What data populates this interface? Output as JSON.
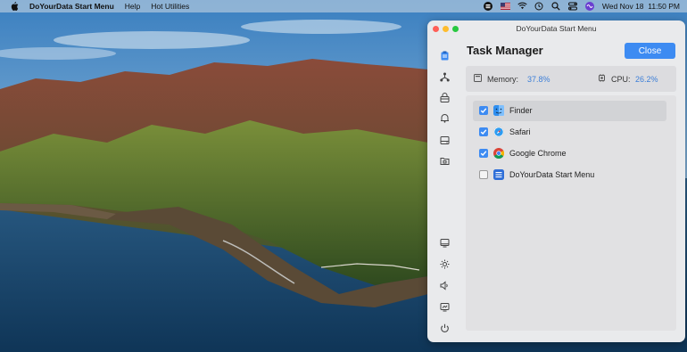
{
  "menubar": {
    "app_name": "DoYourData Start Menu",
    "menus": [
      "Help",
      "Hot Utilities"
    ],
    "datetime": "Wed Nov 18  11:50 PM",
    "status_icons": [
      "start-menu-icon",
      "flag-icon",
      "wifi-icon",
      "battery-icon",
      "time-machine-icon",
      "search-icon",
      "control-center-icon",
      "siri-icon"
    ]
  },
  "window": {
    "title": "DoYourData Start Menu",
    "heading": "Task Manager",
    "close_label": "Close",
    "stats": {
      "memory_label": "Memory:",
      "memory_value": "37.8%",
      "cpu_label": "CPU:",
      "cpu_value": "26.2%"
    },
    "sidebar_icons": [
      "clipboard-icon",
      "network-icon",
      "lock-box-icon",
      "bell-icon",
      "drive-icon",
      "folder-icon",
      "monitor-icon",
      "brightness-icon",
      "volume-icon",
      "display-icon",
      "power-icon"
    ],
    "apps": [
      {
        "name": "Finder",
        "checked": true,
        "selected": true,
        "icon": "finder-icon"
      },
      {
        "name": "Safari",
        "checked": true,
        "selected": false,
        "icon": "safari-icon"
      },
      {
        "name": "Google Chrome",
        "checked": true,
        "selected": false,
        "icon": "chrome-icon"
      },
      {
        "name": "DoYourData Start Menu",
        "checked": false,
        "selected": false,
        "icon": "start-menu-app-icon"
      }
    ]
  },
  "colors": {
    "accent": "#3d8bf2",
    "value_text": "#3d7fd8",
    "window_bg": "#e9eaec"
  }
}
